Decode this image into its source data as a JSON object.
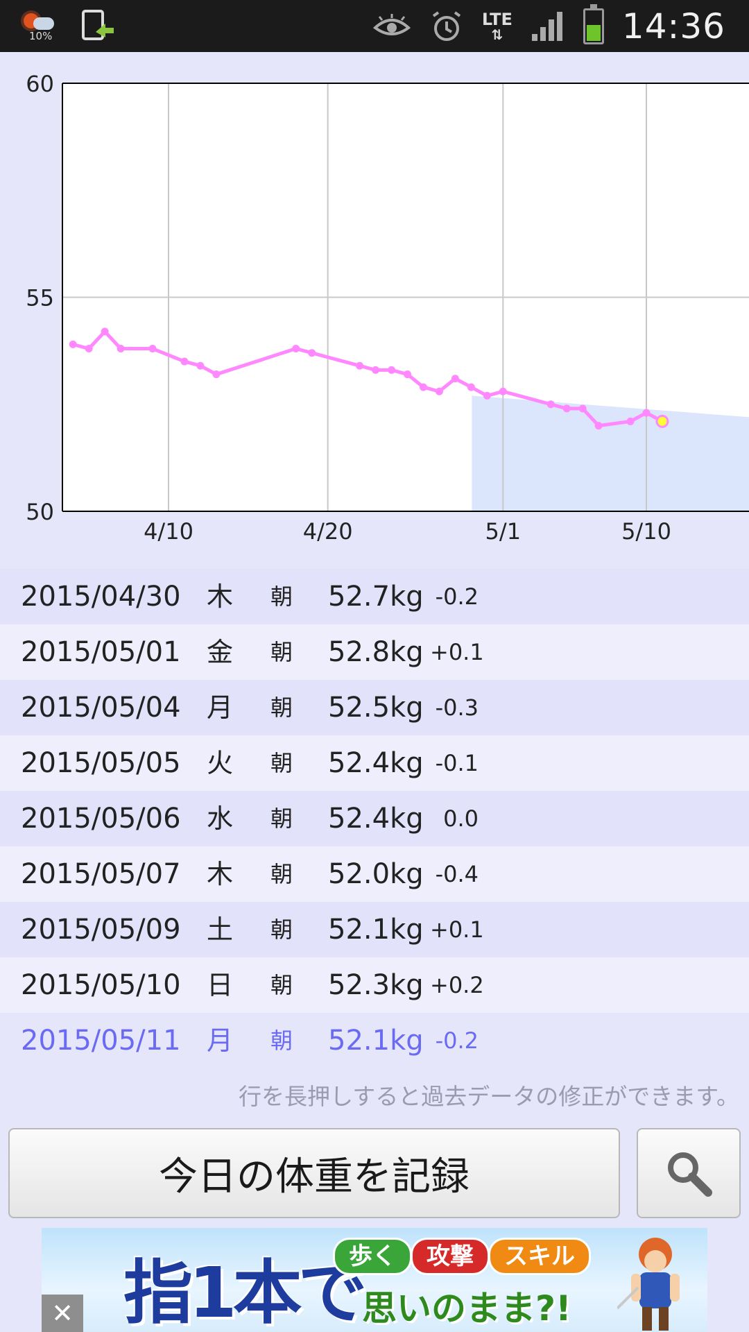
{
  "status_bar": {
    "weather_percent": "10%",
    "time": "14:36",
    "network": "LTE",
    "icons": [
      "weather-icon",
      "download-icon",
      "eye-icon",
      "alarm-icon",
      "lte-icon",
      "signal-icon",
      "battery-icon"
    ]
  },
  "chart_data": {
    "type": "line",
    "y_ticks": [
      "60",
      "55",
      "50"
    ],
    "ylim": [
      50,
      60
    ],
    "x_ticks": [
      "4/10",
      "4/20",
      "5/1",
      "5/10"
    ],
    "grid": true,
    "series": [
      {
        "color": "#ff88ff",
        "points": [
          [
            "04-04",
            53.9
          ],
          [
            "04-05",
            53.8
          ],
          [
            "04-06",
            54.2
          ],
          [
            "04-07",
            53.8
          ],
          [
            "04-09",
            53.8
          ],
          [
            "04-11",
            53.5
          ],
          [
            "04-12",
            53.4
          ],
          [
            "04-13",
            53.2
          ],
          [
            "04-18",
            53.8
          ],
          [
            "04-19",
            53.7
          ],
          [
            "04-22",
            53.4
          ],
          [
            "04-23",
            53.3
          ],
          [
            "04-24",
            53.3
          ],
          [
            "04-25",
            53.2
          ],
          [
            "04-26",
            52.9
          ],
          [
            "04-27",
            52.8
          ],
          [
            "04-28",
            53.1
          ],
          [
            "04-29",
            52.9
          ],
          [
            "04-30",
            52.7
          ],
          [
            "05-01",
            52.8
          ],
          [
            "05-04",
            52.5
          ],
          [
            "05-05",
            52.4
          ],
          [
            "05-06",
            52.4
          ],
          [
            "05-07",
            52.0
          ],
          [
            "05-09",
            52.1
          ],
          [
            "05-10",
            52.3
          ],
          [
            "05-11",
            52.1
          ]
        ]
      }
    ],
    "highlight_point": [
      "05-11",
      52.1
    ],
    "projection_band": {
      "from": "04-30",
      "top_start": 52.7,
      "top_end": 52.2,
      "color": "#dbe5fb"
    }
  },
  "records": [
    {
      "date": "2015/04/30",
      "dow": "木",
      "time": "朝",
      "weight": "52.7kg",
      "diff": "-0.2"
    },
    {
      "date": "2015/05/01",
      "dow": "金",
      "time": "朝",
      "weight": "52.8kg",
      "diff": "+0.1"
    },
    {
      "date": "2015/05/04",
      "dow": "月",
      "time": "朝",
      "weight": "52.5kg",
      "diff": "-0.3"
    },
    {
      "date": "2015/05/05",
      "dow": "火",
      "time": "朝",
      "weight": "52.4kg",
      "diff": "-0.1"
    },
    {
      "date": "2015/05/06",
      "dow": "水",
      "time": "朝",
      "weight": "52.4kg",
      "diff": "0.0"
    },
    {
      "date": "2015/05/07",
      "dow": "木",
      "time": "朝",
      "weight": "52.0kg",
      "diff": "-0.4"
    },
    {
      "date": "2015/05/09",
      "dow": "土",
      "time": "朝",
      "weight": "52.1kg",
      "diff": "+0.1"
    },
    {
      "date": "2015/05/10",
      "dow": "日",
      "time": "朝",
      "weight": "52.3kg",
      "diff": "+0.2"
    },
    {
      "date": "2015/05/11",
      "dow": "月",
      "time": "朝",
      "weight": "52.1kg",
      "diff": "-0.2",
      "current": true
    }
  ],
  "hint": "行を長押しすると過去データの修正ができます。",
  "record_button": "今日の体重を記録",
  "search_button_icon": "search-icon",
  "ad": {
    "big_text": "指1本で",
    "tags": [
      "歩く",
      "攻撃",
      "スキル"
    ],
    "tagline": "思いのまま?!",
    "close": "✕"
  },
  "colors": {
    "background": "#e6e6fb",
    "line": "#ff88ff",
    "current_row": "#6a6af2",
    "highlight": "#ffff33"
  }
}
